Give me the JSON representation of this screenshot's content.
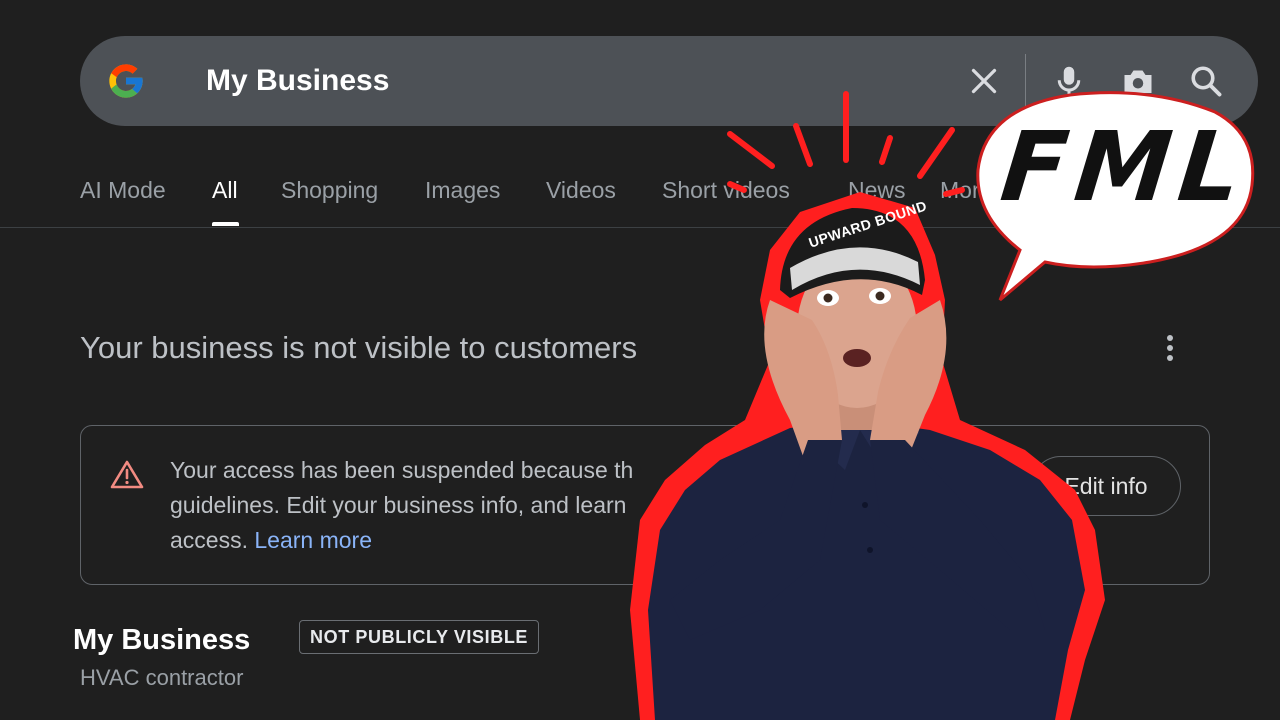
{
  "search": {
    "query": "My Business",
    "icons": [
      "google-logo-icon",
      "clear-icon",
      "microphone-icon",
      "camera-lens-icon",
      "search-icon"
    ]
  },
  "tabs": [
    {
      "label": "AI Mode",
      "active": false
    },
    {
      "label": "All",
      "active": true
    },
    {
      "label": "Shopping",
      "active": false
    },
    {
      "label": "Images",
      "active": false
    },
    {
      "label": "Videos",
      "active": false
    },
    {
      "label": "Short videos",
      "active": false
    },
    {
      "label": "News",
      "active": false
    },
    {
      "label": "More",
      "active": false
    }
  ],
  "panel": {
    "heading": "Your business is not visible to customers",
    "menu_icon": "more-vert-icon"
  },
  "alert": {
    "icon": "warning-icon",
    "line1": "Your access has been suspended because th",
    "line2": "guidelines. Edit your business info, and learn",
    "line3_prefix": "access.",
    "link": "Learn more",
    "button": "Edit info"
  },
  "business": {
    "name": "My Business",
    "badge": "NOT PUBLICLY VISIBLE",
    "category": "HVAC contractor"
  },
  "overlay": {
    "bubble_text": "FML",
    "cap_text": "UPWARD BOUND",
    "outline_color": "#ff1f1f",
    "shirt_color": "#1c2340"
  },
  "colors": {
    "background": "#1f1f1f",
    "search_bar": "#4d5156",
    "link": "#8ab4f8",
    "warning": "#f28b82"
  }
}
